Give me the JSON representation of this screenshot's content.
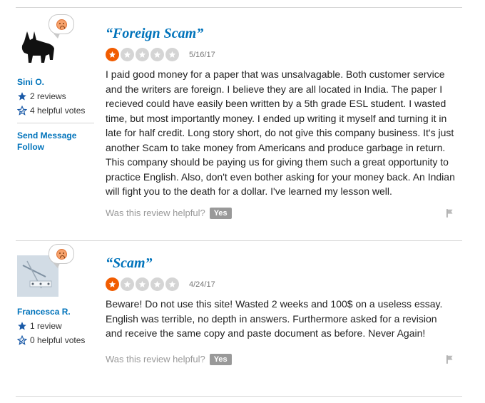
{
  "reviews": [
    {
      "user": {
        "name": "Sini O.",
        "reviews": "2 reviews",
        "helpful_votes": "4 helpful votes"
      },
      "links": {
        "send_message": "Send Message",
        "follow": "Follow"
      },
      "title": "“Foreign Scam”",
      "rating": 1,
      "date": "5/16/17",
      "text": "I paid good money for a paper that was unsalvagable. Both customer service and the writers are foreign. I believe they are all located in India. The paper I recieved could have easily been written by a 5th grade ESL student. I wasted time, but most importantly money. I ended up writing it myself and turning it in late for half credit. Long story short, do not give this company business. It's just another Scam to take money from Americans and produce garbage in return. This company should be paying us for giving them such a great opportunity to practice English. Also, don't even bother asking for your money back. An Indian will fight you to the death for a dollar. I've learned my lesson well.",
      "helpful_prompt": "Was this review helpful?",
      "yes_label": "Yes"
    },
    {
      "user": {
        "name": "Francesca R.",
        "reviews": "1 review",
        "helpful_votes": "0 helpful votes"
      },
      "title": "“Scam”",
      "rating": 1,
      "date": "4/24/17",
      "text": "Beware! Do not use this site! Wasted 2 weeks and 100$ on a useless essay. English was terrible, no depth in answers. Furthermore asked for a revision and receive the same copy and paste document as before. Never Again!",
      "helpful_prompt": "Was this review helpful?",
      "yes_label": "Yes"
    }
  ],
  "colors": {
    "link": "#0073bb",
    "star_on": "#f15c00",
    "star_off": "#d5d5d5"
  },
  "icons": [
    "sad-face-icon",
    "star-icon",
    "helpful-star-icon",
    "flag-icon"
  ]
}
